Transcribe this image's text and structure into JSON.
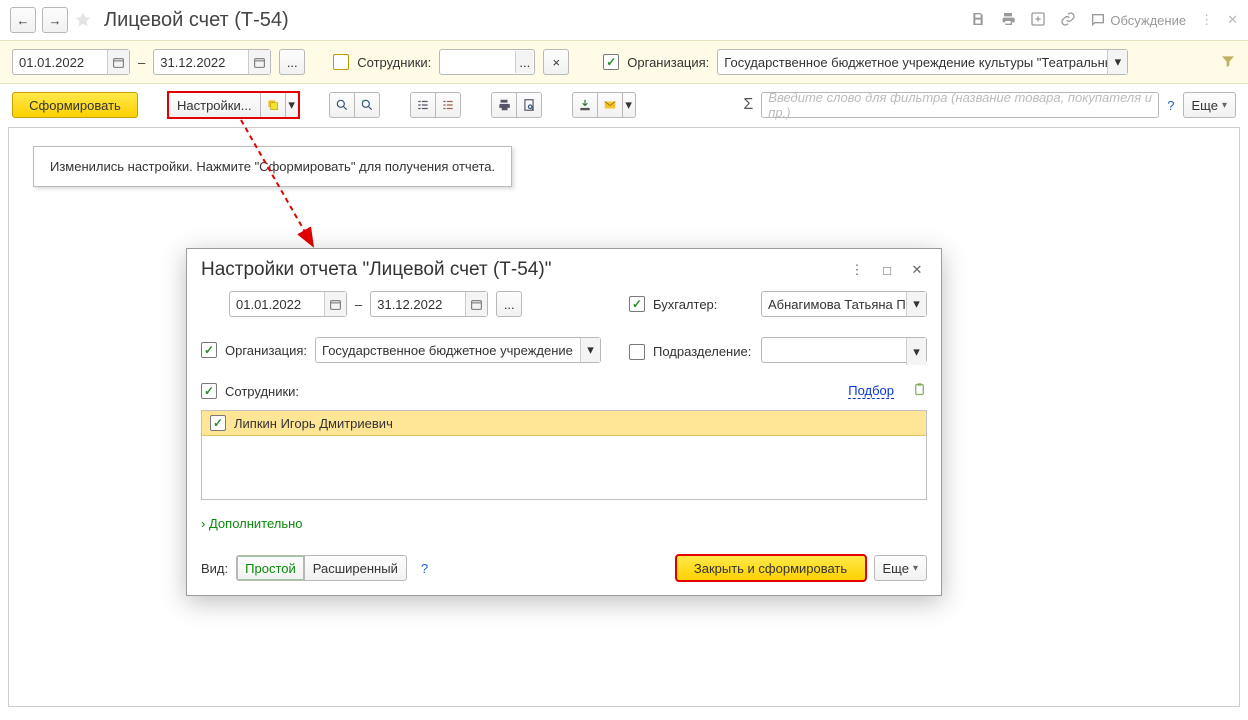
{
  "title": "Лицевой счет (Т-54)",
  "filter": {
    "date_from": "01.01.2022",
    "date_to": "31.12.2022",
    "dash": "–",
    "employees_label": "Сотрудники:",
    "employees_value": "",
    "org_label": "Организация:",
    "org_value": "Государственное бюджетное учреждение культуры \"Театральный"
  },
  "toolbar": {
    "form": "Сформировать",
    "settings": "Настройки...",
    "filter_placeholder": "Введите слово для фильтра (название товара, покупателя и пр.)",
    "more": "Еще"
  },
  "info": "Изменились настройки. Нажмите \"Сформировать\" для получения отчета.",
  "dialog": {
    "title": "Настройки отчета \"Лицевой счет (Т-54)\"",
    "date_from": "01.01.2022",
    "date_to": "31.12.2022",
    "dash": "–",
    "org_label": "Организация:",
    "org_value": "Государственное бюджетное учреждение",
    "acc_label": "Бухгалтер:",
    "acc_value": "Абнагимова Татьяна Пет",
    "dep_label": "Подразделение:",
    "dep_value": "",
    "emp_label": "Сотрудники:",
    "pick": "Подбор",
    "emp_row": "Липкин Игорь Дмитриевич",
    "more_link": "Дополнительно",
    "view_label": "Вид:",
    "view_simple": "Простой",
    "view_ext": "Расширенный",
    "close_form": "Закрыть и сформировать",
    "more": "Еще"
  },
  "header_links": {
    "discuss": "Обсуждение"
  }
}
